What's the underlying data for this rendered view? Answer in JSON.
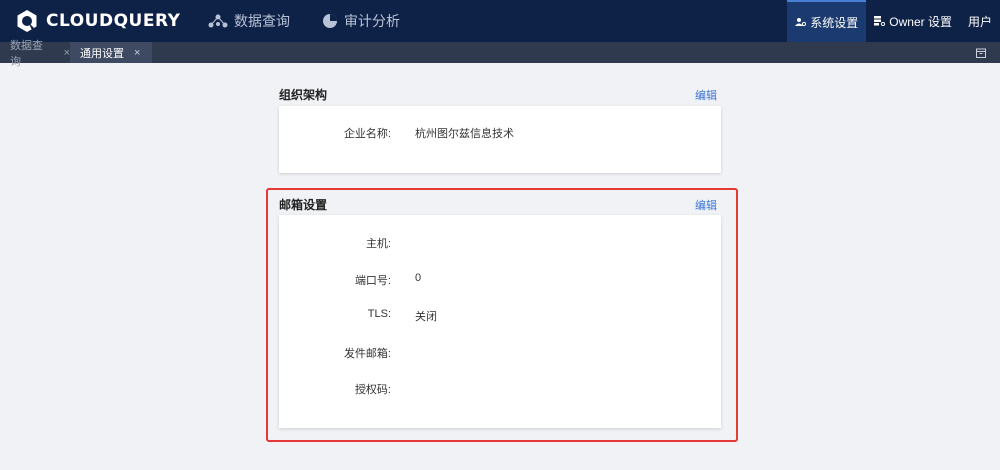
{
  "app": {
    "brand": "CLOUDQUERY"
  },
  "nav": [
    {
      "label": "数据查询",
      "icon": "nodes-icon"
    },
    {
      "label": "审计分析",
      "icon": "pie-chart-icon"
    }
  ],
  "top_right": {
    "system_settings": "系统设置",
    "owner_settings": "Owner 设置",
    "users": "用户"
  },
  "tabs": [
    {
      "label": "数据查询",
      "close": "×"
    },
    {
      "label": "通用设置",
      "close": "×"
    }
  ],
  "org": {
    "title": "组织架构",
    "edit": "编辑",
    "company_label": "企业名称:",
    "company_value": "杭州图尔兹信息技术"
  },
  "mail": {
    "title": "邮箱设置",
    "edit": "编辑",
    "host_label": "主机:",
    "host_value": "",
    "port_label": "端口号:",
    "port_value": "0",
    "tls_label": "TLS:",
    "tls_value": "关闭",
    "sender_label": "发件邮箱:",
    "sender_value": "",
    "auth_label": "授权码:",
    "auth_value": ""
  },
  "colors": {
    "topbar": "#0e2147",
    "tabbar": "#2f3a4e",
    "accent": "#3b74d9",
    "highlight": "#e53935",
    "background": "#f0f2f5"
  }
}
